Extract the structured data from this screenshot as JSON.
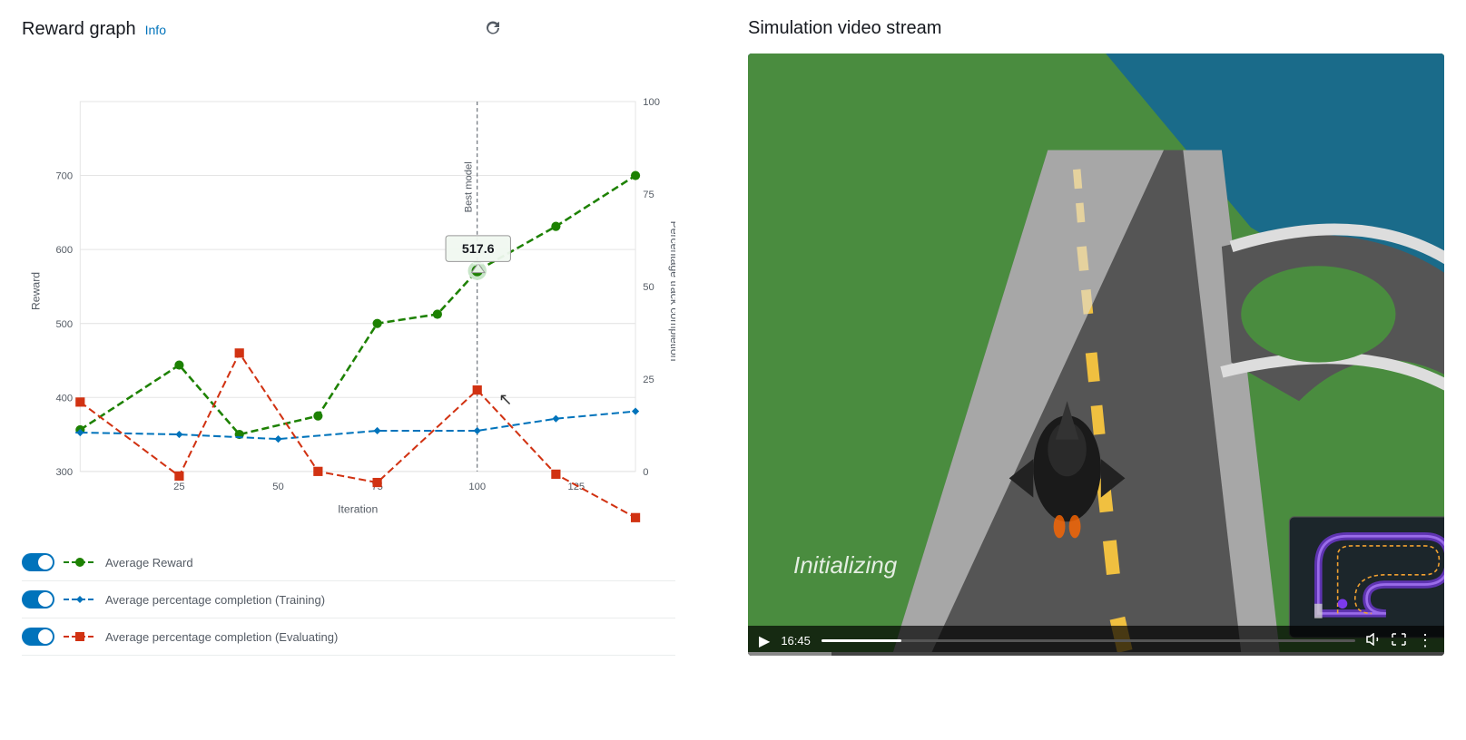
{
  "left": {
    "title": "Reward graph",
    "info_label": "Info",
    "chart": {
      "tooltip_value": "517.6",
      "best_model_label": "Best model",
      "x_axis_label": "Iteration",
      "y_axis_left_label": "Reward",
      "y_axis_right_label": "Percentage track completion",
      "y_left_ticks": [
        "300",
        "400",
        "500",
        "600",
        "700"
      ],
      "y_right_ticks": [
        "0",
        "25",
        "50",
        "75",
        "100"
      ],
      "x_ticks": [
        "25",
        "50",
        "75",
        "100",
        "125"
      ]
    },
    "legend": [
      {
        "id": "avg-reward",
        "label": "Average Reward",
        "color": "#1d8102",
        "line_style": "dashed",
        "enabled": true
      },
      {
        "id": "avg-pct-training",
        "label": "Average percentage completion (Training)",
        "color": "#0073bb",
        "line_style": "dashed",
        "enabled": true
      },
      {
        "id": "avg-pct-evaluating",
        "label": "Average percentage completion (Evaluating)",
        "color": "#d13212",
        "line_style": "dashed",
        "enabled": true
      }
    ]
  },
  "right": {
    "title": "Simulation video stream",
    "video": {
      "status_text": "Initializing",
      "time": "16:45"
    }
  }
}
